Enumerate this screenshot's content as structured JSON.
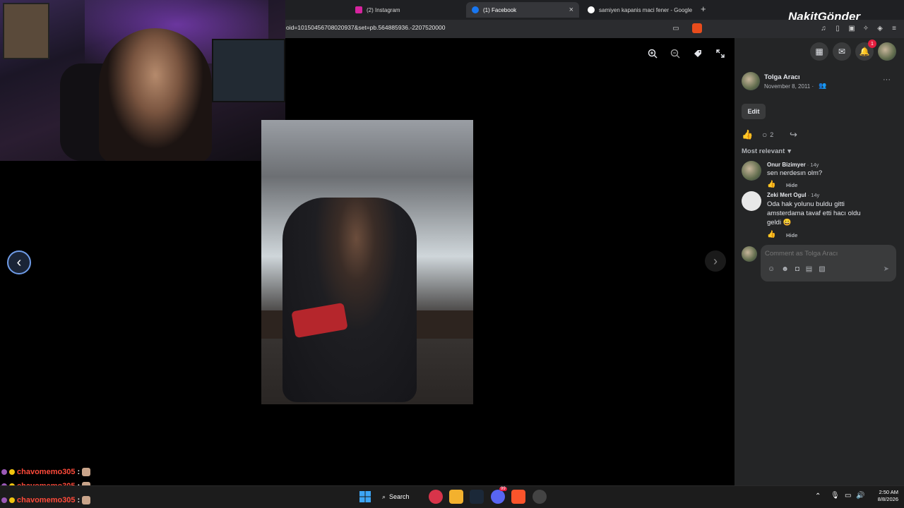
{
  "browser": {
    "tabs": [
      {
        "label": "(2) Instagram",
        "active": false,
        "favicon": "instagram-icon",
        "color": "#d6249f"
      },
      {
        "label": "(1) Facebook",
        "active": true,
        "favicon": "facebook-icon",
        "color": "#1877f2"
      },
      {
        "label": "samiyen kapanis maci fener - Google",
        "active": false,
        "favicon": "google-icon",
        "color": "#ffffff"
      }
    ],
    "close_tab": "×",
    "new_tab": "+",
    "url": "oid=10150456708020937&set=pb.564885936.-2207520000"
  },
  "overlay_brand": "NakitGönder",
  "viewer": {
    "zoom_in": "+",
    "zoom_out": "−",
    "prev": "‹",
    "next": "›"
  },
  "post": {
    "author": "Tolga Aracı",
    "date": "November 8, 2011 ·",
    "more": "···",
    "edit_label": "Edit",
    "comment_count": "2",
    "sort_label": "Most relevant",
    "notification_count": "1"
  },
  "comments": [
    {
      "author": "Onur Bizimyer",
      "time": "· 14y",
      "text": "sen nerdesın olm?",
      "hide": "Hide"
    },
    {
      "author": "Zeki Mert Ogul",
      "time": "· 14y",
      "text": "Oda hak yolunu buldu gitti amsterdama tavaf etti hacı oldu geldi 😀",
      "hide": "Hide"
    }
  ],
  "comment_input": {
    "placeholder": "Comment as Tolga Aracı"
  },
  "chat": [
    {
      "user": "chavomemo305",
      "sep": ":"
    },
    {
      "user": "chavomemo305",
      "sep": ":"
    },
    {
      "user": "chavomemo305",
      "sep": ":"
    }
  ],
  "taskbar": {
    "search_label": "Search",
    "time": "2:50 AM",
    "date": "8/8/2026",
    "discord_badge": "99"
  },
  "colors": {
    "accent": "#1877f2",
    "panel_bg": "#242526",
    "chat_name": "#ff4a3a"
  }
}
